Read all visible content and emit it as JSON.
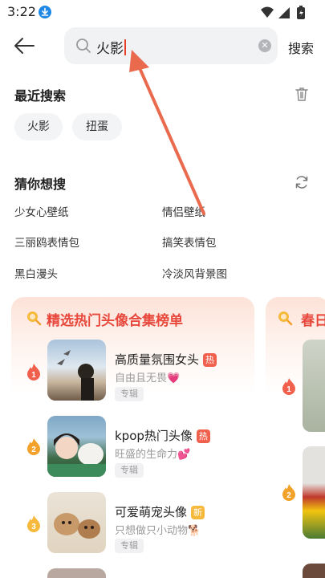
{
  "status_bar": {
    "time": "3:22"
  },
  "search": {
    "query": "火影",
    "button_label": "搜索"
  },
  "recent": {
    "title": "最近搜索",
    "items": [
      "火影",
      "扭蛋"
    ]
  },
  "guess": {
    "title": "猜你想搜",
    "items": [
      "少女心壁纸",
      "情侣壁纸",
      "三丽鸥表情包",
      "搞笑表情包",
      "黑白漫头",
      "冷淡风背景图"
    ]
  },
  "card1": {
    "title": "精选热门头像合集榜单",
    "items": [
      {
        "rank": "1",
        "title": "高质量氛围女头",
        "tag": "热",
        "subtitle": "自由且无畏💗",
        "badge": "专辑"
      },
      {
        "rank": "2",
        "title": "kpop热门头像",
        "tag": "热",
        "subtitle": "旺盛的生命力💕",
        "badge": "专辑"
      },
      {
        "rank": "3",
        "title": "可爱萌宠头像",
        "tag": "新",
        "subtitle": "只想做只小动物🐕",
        "badge": "专辑"
      }
    ]
  },
  "card2": {
    "title": "春日",
    "ranks": [
      "1",
      "2"
    ]
  },
  "colors": {
    "accent": "#e8473b",
    "hot_tag": "#f0604d",
    "new_tag": "#f6b93b",
    "arrow": "#ea6a4e"
  }
}
